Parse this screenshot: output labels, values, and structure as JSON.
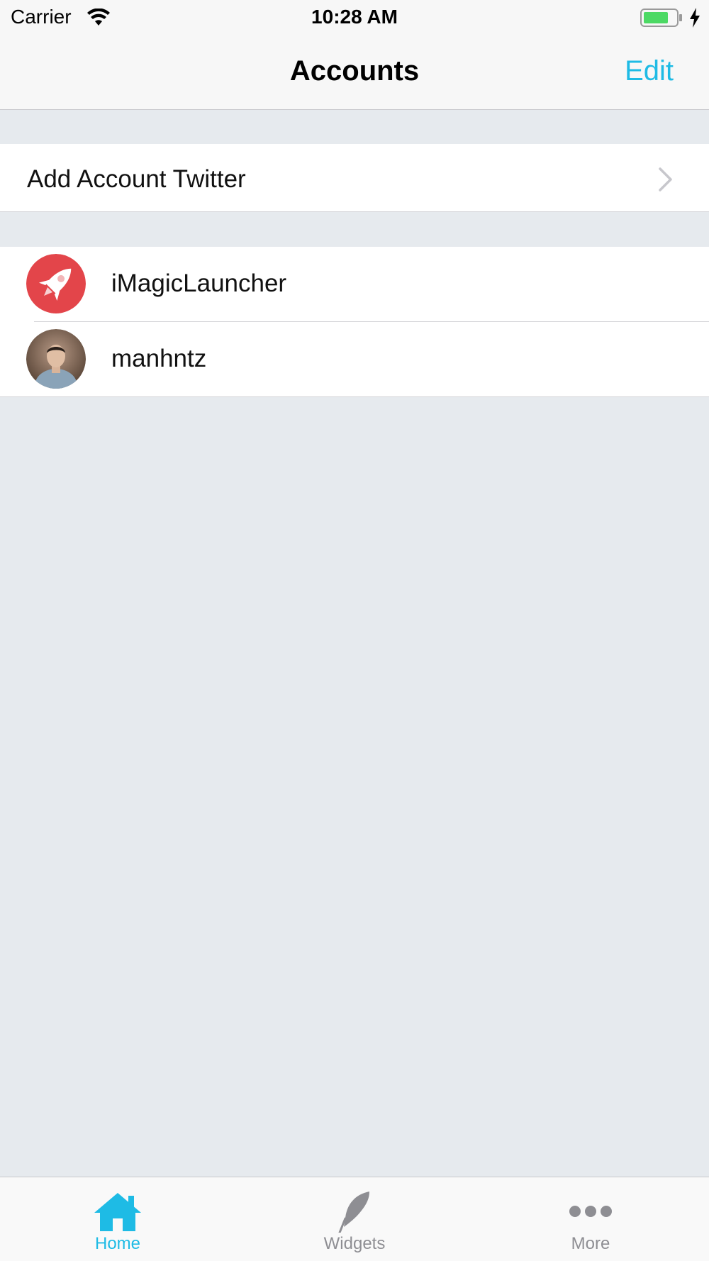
{
  "status_bar": {
    "carrier": "Carrier",
    "time": "10:28 AM"
  },
  "nav": {
    "title": "Accounts",
    "edit_label": "Edit"
  },
  "add_row": {
    "label": "Add Account Twitter"
  },
  "accounts": [
    {
      "name": "iMagicLauncher",
      "avatar": "rocket-logo-avatar"
    },
    {
      "name": "manhntz",
      "avatar": "user-photo-avatar"
    }
  ],
  "tabs": [
    {
      "label": "Home",
      "icon": "home-icon",
      "active": true
    },
    {
      "label": "Widgets",
      "icon": "feather-icon",
      "active": false
    },
    {
      "label": "More",
      "icon": "more-dots-icon",
      "active": false
    }
  ],
  "colors": {
    "accent": "#1ebbe5",
    "background": "#e6eaee",
    "inactive_tab": "#8e8e93",
    "battery_fill": "#4cd964",
    "avatar_red": "#e3454a"
  }
}
